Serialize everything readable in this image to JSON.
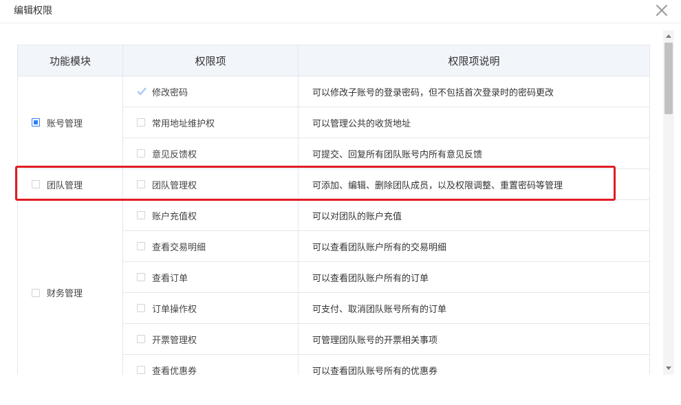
{
  "dialog": {
    "title": "编辑权限"
  },
  "table": {
    "headers": {
      "module": "功能模块",
      "permission": "权限项",
      "description": "权限项说明"
    },
    "modules": [
      {
        "label": "账号管理",
        "state": "partial"
      },
      {
        "label": "团队管理",
        "state": "unchecked"
      },
      {
        "label": "财务管理",
        "state": "unchecked"
      }
    ],
    "rows": [
      {
        "permission": "修改密码",
        "description": "可以修改子账号的登录密码，但不包括首次登录时的密码更改",
        "state": "disabled-checked"
      },
      {
        "permission": "常用地址维护权",
        "description": "可以管理公共的收货地址",
        "state": "unchecked"
      },
      {
        "permission": "意见反馈权",
        "description": "可提交、回复所有团队账号内所有意见反馈",
        "state": "unchecked"
      },
      {
        "permission": "团队管理权",
        "description": "可添加、编辑、删除团队成员，以及权限调整、重置密码等管理",
        "state": "unchecked"
      },
      {
        "permission": "账户充值权",
        "description": "可以对团队的账户充值",
        "state": "unchecked"
      },
      {
        "permission": "查看交易明细",
        "description": "可以查看团队账户所有的交易明细",
        "state": "unchecked"
      },
      {
        "permission": "查看订单",
        "description": "可以查看团队账户所有的订单",
        "state": "unchecked"
      },
      {
        "permission": "订单操作权",
        "description": "可支付、取消团队账号所有的订单",
        "state": "unchecked"
      },
      {
        "permission": "开票管理权",
        "description": "可管理团队账号的开票相关事项",
        "state": "unchecked"
      },
      {
        "permission": "查看优惠券",
        "description": "可以查看团队账号所有的优惠券",
        "state": "unchecked"
      }
    ]
  },
  "icons": {
    "close": "close-icon",
    "check": "check-icon"
  },
  "colors": {
    "highlight": "#e01b22",
    "accent": "#2d7ff9",
    "header_bg": "#f2f5fa"
  }
}
